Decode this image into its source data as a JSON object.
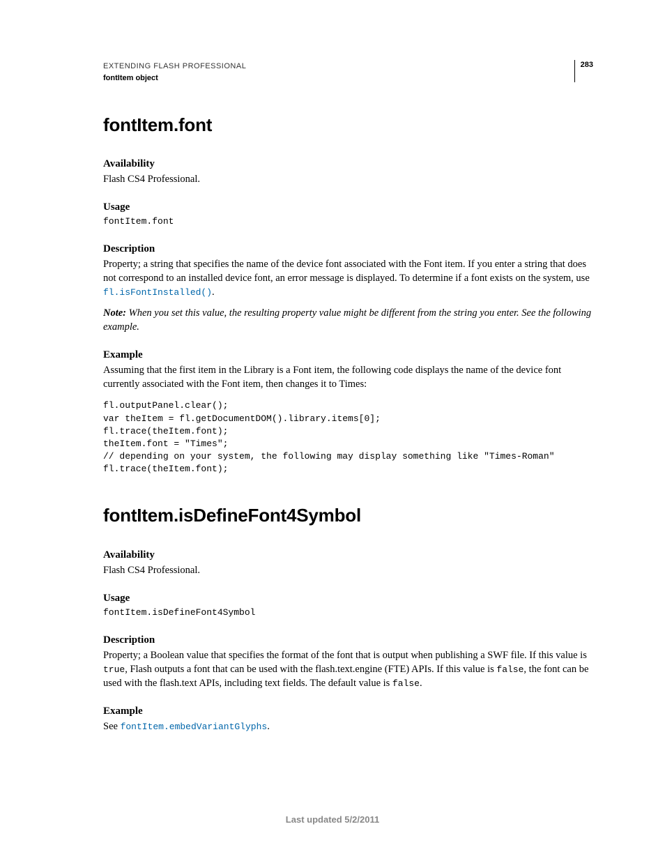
{
  "header": {
    "title": "EXTENDING FLASH PROFESSIONAL",
    "subtitle": "fontItem object",
    "page_number": "283"
  },
  "sections": [
    {
      "heading": "fontItem.font",
      "availability_label": "Availability",
      "availability_text": "Flash CS4 Professional.",
      "usage_label": "Usage",
      "usage_code": "fontItem.font",
      "description_label": "Description",
      "description_pre": "Property; a string that specifies the name of the device font associated with the Font item. If you enter a string that does not correspond to an installed device font, an error message is displayed. To determine if a font exists on the system, use ",
      "description_link": "fl.isFontInstalled()",
      "description_post": ".",
      "note_label": "Note: ",
      "note_text": "When you set this value, the resulting property value might be different from the string you enter. See the following example.",
      "example_label": "Example",
      "example_text": "Assuming that the first item in the Library is a Font item, the following code displays the name of the device font currently associated with the Font item, then changes it to Times:",
      "example_code": "fl.outputPanel.clear();\nvar theItem = fl.getDocumentDOM().library.items[0];\nfl.trace(theItem.font);\ntheItem.font = \"Times\";\n// depending on your system, the following may display something like \"Times-Roman\"\nfl.trace(theItem.font);"
    },
    {
      "heading": "fontItem.isDefineFont4Symbol",
      "availability_label": "Availability",
      "availability_text": "Flash CS4 Professional.",
      "usage_label": "Usage",
      "usage_code": "fontItem.isDefineFont4Symbol",
      "description_label": "Description",
      "description_pre": "Property; a Boolean value that specifies the format of the font that is output when publishing a SWF file. If this value is ",
      "description_code1": "true",
      "description_mid": ", Flash outputs a font that can be used with the flash.text.engine (FTE) APIs. If this value is ",
      "description_code2": "false",
      "description_post": ", the font can be used with the flash.text APIs, including text fields. The default value is ",
      "description_code3": "false",
      "description_end": ".",
      "example_label": "Example",
      "example_pre": "See ",
      "example_link": "fontItem.embedVariantGlyphs",
      "example_post": "."
    }
  ],
  "footer": "Last updated 5/2/2011"
}
